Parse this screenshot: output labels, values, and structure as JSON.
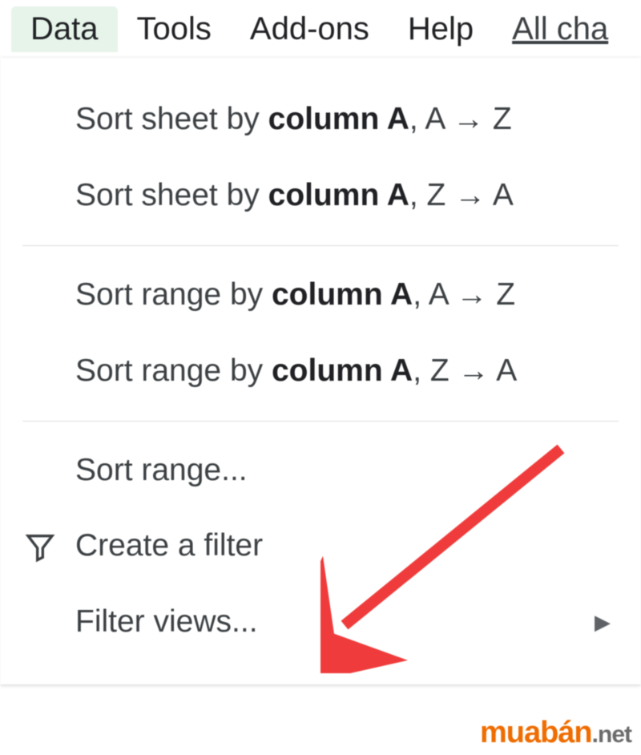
{
  "menubar": {
    "items": [
      {
        "label": "Data",
        "active": true
      },
      {
        "label": "Tools",
        "active": false
      },
      {
        "label": "Add-ons",
        "active": false
      },
      {
        "label": "Help",
        "active": false
      }
    ],
    "link": "All cha"
  },
  "dropdown": {
    "items": [
      {
        "pre": "Sort sheet by ",
        "bold": "column A",
        "post": ", A → Z",
        "icon": "",
        "submenu": false
      },
      {
        "pre": "Sort sheet by ",
        "bold": "column A",
        "post": ", Z → A",
        "icon": "",
        "submenu": false
      },
      {
        "divider": true
      },
      {
        "pre": "Sort range by ",
        "bold": "column A",
        "post": ", A → Z",
        "icon": "",
        "submenu": false
      },
      {
        "pre": "Sort range by ",
        "bold": "column A",
        "post": ", Z → A",
        "icon": "",
        "submenu": false
      },
      {
        "divider": true
      },
      {
        "pre": "Sort range...",
        "bold": "",
        "post": "",
        "icon": "",
        "submenu": false
      },
      {
        "pre": "Create a filter",
        "bold": "",
        "post": "",
        "icon": "filter",
        "submenu": false
      },
      {
        "pre": "Filter views...",
        "bold": "",
        "post": "",
        "icon": "",
        "submenu": true
      }
    ]
  },
  "watermark": {
    "brand": "muabán",
    "suffix": ".net"
  },
  "colors": {
    "arrow": "#ef3b3b",
    "menu_active_bg": "#e6f4ea",
    "text": "#3c4043"
  }
}
